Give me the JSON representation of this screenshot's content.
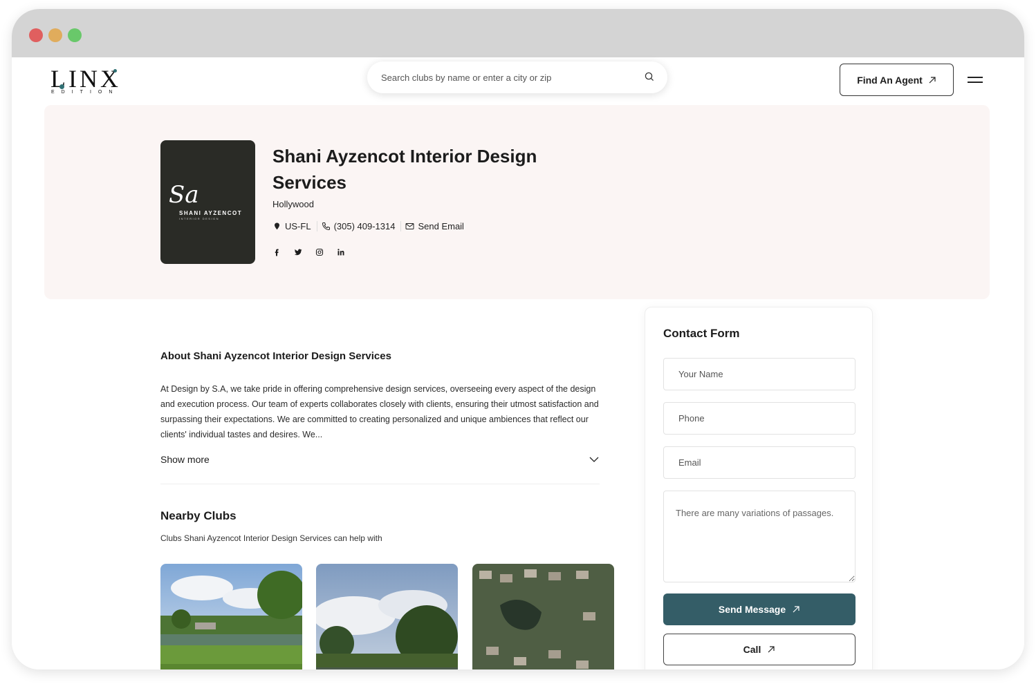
{
  "brand": {
    "logo_text": "LINX",
    "logo_sub": "EDITION",
    "accent_color": "#2f6f73"
  },
  "header": {
    "search_placeholder": "Search clubs by name or enter a city or zip",
    "find_agent_label": "Find An Agent"
  },
  "profile": {
    "logo_signature": "Sa",
    "logo_name": "SHANI AYZENCOT",
    "logo_tagline": "INTERIOR DESIGN",
    "title": "Shani Ayzencot Interior Design Services",
    "city": "Hollywood",
    "location": "US-FL",
    "phone": "(305) 409-1314",
    "email_label": "Send Email",
    "social": [
      "facebook",
      "twitter",
      "instagram",
      "linkedin"
    ]
  },
  "about": {
    "title": "About Shani Ayzencot Interior Design Services",
    "text": "At Design by S.A, we take pride in offering comprehensive design services, overseeing every aspect of the design and execution process. Our team of experts collaborates closely with clients, ensuring their utmost satisfaction and surpassing their expectations. We are committed to creating personalized and unique ambiences that reflect our clients' individual tastes and desires. We...",
    "show_more_label": "Show more"
  },
  "nearby": {
    "title": "Nearby Clubs",
    "subtitle": "Clubs Shani Ayzencot Interior Design Services can help with"
  },
  "contact": {
    "title": "Contact Form",
    "name_placeholder": "Your Name",
    "phone_placeholder": "Phone",
    "email_placeholder": "Email",
    "message_placeholder": "There are many variations of passages.",
    "send_label": "Send Message",
    "call_label": "Call",
    "button_color": "#345d67"
  }
}
